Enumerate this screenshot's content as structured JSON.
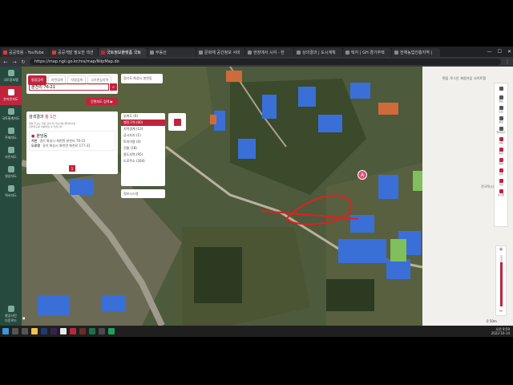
{
  "browser": {
    "tabs": [
      {
        "label": "공공학용 - YouTube",
        "color": "#e53935"
      },
      {
        "label": "공공개발 필요한 섹션",
        "color": "#e53935"
      },
      {
        "label": "국토정보플랫폼 국토",
        "color": "#c0243c"
      },
      {
        "label": "부동산",
        "color": "#555"
      },
      {
        "label": "문화재 공간정보 서비",
        "color": "#555"
      },
      {
        "label": "현장에서 시야 - 한",
        "color": "#555"
      },
      {
        "label": "상의결과 | 도시계획",
        "color": "#555"
      },
      {
        "label": "택지 | GH 경기주택",
        "color": "#555"
      },
      {
        "label": "전체농업진흥지역 |",
        "color": "#555"
      }
    ],
    "active_tab": 2,
    "url": "https://map.ngii.go.kr/ms/map/NlipMap.do"
  },
  "leftnav": {
    "logo": "국토정보맵",
    "items": [
      {
        "label": "국토정보맵"
      },
      {
        "label": "온라인지도"
      },
      {
        "label": "국토통계지도"
      },
      {
        "label": "주제지도"
      },
      {
        "label": "사진지도"
      },
      {
        "label": "영상지도"
      },
      {
        "label": "역사지도"
      }
    ],
    "bottom": "항공사진\n다운로드"
  },
  "search": {
    "tabs": [
      "통합검색",
      "지번검색",
      "지명검색",
      "국가관심지역"
    ],
    "query": "분천리 76-21",
    "detail_button": "간편지도 검색 ▶"
  },
  "results": {
    "title": "검색결과",
    "count": "총 1건",
    "note1": "해당 주소는 지번 검색 후 더보기를 클릭하시면",
    "note2": "관련지도를 이용하실 수 있습니다.",
    "item_title": "분당동",
    "jibun_label": "지번",
    "jibun_value": "경기 화성시 화천면 분천리 76-21",
    "road_label": "도로명",
    "road_value": "경기 화성시 화천면 화천로 177-31",
    "page": "1"
  },
  "layers": {
    "header": "경기도 화성시 봉천동",
    "items": [
      {
        "label": "부위도 (0)"
      },
      {
        "label": "행정구역 (60)"
      },
      {
        "label": "지적경계 (13)"
      },
      {
        "label": "공시지가 (1)"
      },
      {
        "label": "토지이용 (0)"
      },
      {
        "label": "건물 (18)"
      },
      {
        "label": "용도지역 (95)"
      },
      {
        "label": "도로주소 (264)"
      }
    ],
    "selected": 1,
    "info_label": "정보시스템"
  },
  "map": {
    "marker": "A",
    "place_label": "전국택시업협회"
  },
  "right": {
    "tabs": [
      "편집",
      "로그인",
      "회원가입",
      "사이트맵"
    ],
    "tools": [
      "",
      "정보",
      "도로",
      "경로",
      "즐겨찾기",
      "이동",
      "측정",
      "화면",
      "인쇄",
      "저장",
      "초기화"
    ],
    "scale": "0  50m"
  },
  "taskbar": {
    "time": "오전 9:59",
    "date": "2022-10-14"
  }
}
